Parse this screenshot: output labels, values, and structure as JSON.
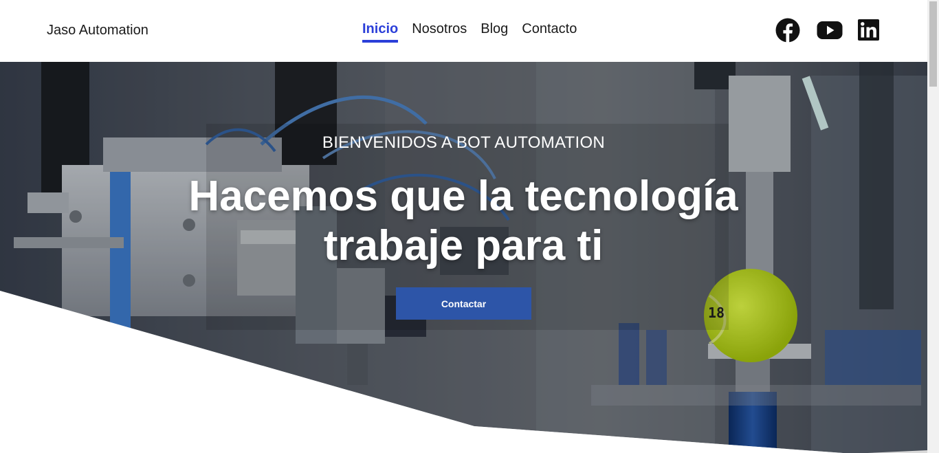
{
  "header": {
    "brand": "Jaso Automation",
    "nav": [
      {
        "label": "Inicio",
        "active": true
      },
      {
        "label": "Nosotros",
        "active": false
      },
      {
        "label": "Blog",
        "active": false
      },
      {
        "label": "Contacto",
        "active": false
      }
    ],
    "social": [
      "facebook-icon",
      "youtube-icon",
      "linkedin-icon"
    ]
  },
  "hero": {
    "kicker": "BIENVENIDOS A BOT AUTOMATION",
    "title": "Hacemos que la tecnología trabaje para ti",
    "cta_label": "Contactar",
    "ball_label": "18"
  },
  "colors": {
    "accent": "#2b3fd9",
    "button": "#2d55a8",
    "wedge_grey": "#d9d9d9"
  }
}
